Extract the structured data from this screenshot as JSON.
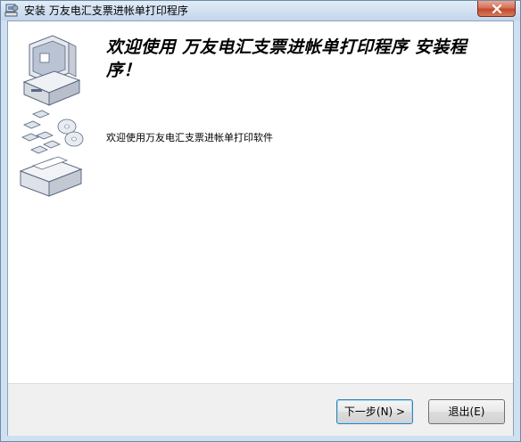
{
  "window": {
    "title": "安装 万友电汇支票进帐单打印程序"
  },
  "welcome": {
    "title": "欢迎使用 万友电汇支票进帐单打印程序 安装程序！",
    "description": "欢迎使用万友电汇支票进帐单打印软件"
  },
  "buttons": {
    "next": "下一步(N) >",
    "exit": "退出(E)"
  },
  "icons": {
    "app": "installer-icon",
    "close": "close-icon",
    "illustration": "computer-disks-illustration"
  },
  "colors": {
    "close_button": "#c2492b",
    "titlebar": "#cfe0f1",
    "default_button_border": "#3c7fb1"
  }
}
